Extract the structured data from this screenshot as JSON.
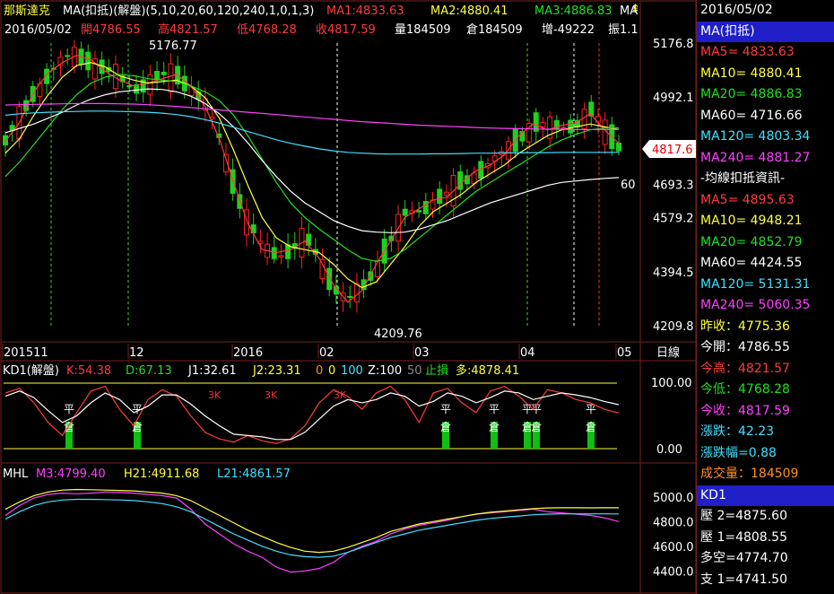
{
  "header": {
    "name": "那斯達克",
    "ma_title": "MA(扣抵)(解盤)(5,10,20,60,120,240,1,0,1,3)",
    "ma1": "MA1:4833.63",
    "ma2": "MA2:4880.41",
    "ma3": "MA3:4886.83",
    "ma_more": "MA",
    "date": "2016/05/02",
    "open": "開4786.55",
    "high": "高4821.57",
    "low": "低4768.28",
    "close": "收4817.59",
    "vol": "量184509",
    "pos": "倉184509",
    "chg": "增-49222",
    "amp": "振1.1"
  },
  "annotations": {
    "peak": "5176.77",
    "trough": "4209.76",
    "ma60_tag": "60",
    "last_price": "4817.6"
  },
  "price_axis": [
    "5176.8",
    "4992.1",
    "4807.6",
    "4693.3",
    "4579.2",
    "4394.5",
    "4209.8"
  ],
  "time_axis": [
    "201511",
    "12",
    "2016",
    "02",
    "03",
    "04",
    "05"
  ],
  "period_label": "日線",
  "kd": {
    "title": "KD1(解盤)",
    "k": "K:54.38",
    "d": "D:67.13",
    "j1": "J1:32.61",
    "j2": "J2:23.31",
    "params": [
      "0",
      "0",
      "100",
      "Z:100",
      "50"
    ],
    "stop": "止損",
    "long": "多:4878.41",
    "axis": [
      "100.00",
      "0.00"
    ],
    "ping": "平",
    "cang": "倉",
    "three_k": "3K"
  },
  "mhl": {
    "title": "MHL",
    "m3": "M3:4799.40",
    "h21": "H21:4911.68",
    "l21": "L21:4861.57",
    "axis": [
      "5000.0",
      "4800.0",
      "4600.0",
      "4400.0"
    ]
  },
  "sidebar": {
    "date": "2016/05/02",
    "ma_head": "MA(扣抵)",
    "ma": [
      {
        "label": "MA5= 4833.63",
        "color": "#ff3b3b"
      },
      {
        "label": "MA10= 4880.41",
        "color": "#ffff40"
      },
      {
        "label": "MA20= 4886.83",
        "color": "#20e020"
      },
      {
        "label": "MA60= 4716.66",
        "color": "#ffffff"
      },
      {
        "label": "MA120= 4803.34",
        "color": "#40e0ff"
      },
      {
        "label": "MA240= 4881.27",
        "color": "#ff40ff"
      }
    ],
    "deduct_head": "-均線扣抵資訊-",
    "deduct": [
      {
        "label": "MA5= 4895.63",
        "color": "#ff3b3b"
      },
      {
        "label": "MA10= 4948.21",
        "color": "#ffff40"
      },
      {
        "label": "MA20= 4852.79",
        "color": "#20e020"
      },
      {
        "label": "MA60= 4424.55",
        "color": "#ffffff"
      },
      {
        "label": "MA120= 5131.31",
        "color": "#40e0ff"
      },
      {
        "label": "MA240= 5060.35",
        "color": "#ff40ff"
      }
    ],
    "quote": [
      {
        "label": "昨收：4775.36",
        "color": "#ffff40"
      },
      {
        "label": "今開：4786.55",
        "color": "#ffffff"
      },
      {
        "label": "今高：4821.57",
        "color": "#ff3b3b"
      },
      {
        "label": "今低：4768.28",
        "color": "#20e020"
      },
      {
        "label": "今收：4817.59",
        "color": "#ff40ff"
      },
      {
        "label": "漲跌：42.23",
        "color": "#40e0ff"
      },
      {
        "label": "漲跌幅=0.88",
        "color": "#40e0ff"
      },
      {
        "label": "成交量：184509",
        "color": "#ff9020"
      }
    ],
    "kd_head": "KD1",
    "kd_rows": [
      {
        "label": "壓 2=4875.60",
        "color": "#ffffff"
      },
      {
        "label": "壓 1=4808.55",
        "color": "#ffffff"
      },
      {
        "label": "多空=4774.70",
        "color": "#ffffff"
      },
      {
        "label": "支 1=4741.50",
        "color": "#ffffff"
      }
    ]
  },
  "colors": {
    "up": "#ff2020",
    "down": "#20d020",
    "ma5": "#ff3b3b",
    "ma10": "#ffff40",
    "ma20": "#20e020",
    "ma60": "#ffffff",
    "ma120": "#40e0ff",
    "ma240": "#ff40ff",
    "frame": "#7a1f1f",
    "dashed_green": "#30e030",
    "dashed_white": "#ffffff",
    "dashed_red": "#ff3030"
  },
  "chart_data": [
    {
      "type": "line",
      "panel": "price",
      "title": "MA(扣抵)(解盤)(5,10,20,60,120,240,1,0,1,3)",
      "xlabel": "",
      "ylabel": "",
      "ylim": [
        4209.8,
        5176.8
      ],
      "x_ticks": [
        "201511",
        "12",
        "2016",
        "02",
        "03",
        "04",
        "05"
      ],
      "y_ticks": [
        5176.8,
        4992.1,
        4807.6,
        4693.3,
        4579.2,
        4394.5,
        4209.8
      ],
      "candles_summary": {
        "peak": 5176.77,
        "trough": 4209.76,
        "last_close": 4817.59
      },
      "series": [
        {
          "name": "MA5",
          "color": "#ff3b3b",
          "values": [
            4840,
            4905,
            5010,
            5075,
            5110,
            5135,
            5120,
            5080,
            5050,
            5030,
            5040,
            5055,
            5070,
            5030,
            4960,
            4850,
            4700,
            4560,
            4470,
            4460,
            4470,
            4500,
            4440,
            4350,
            4290,
            4330,
            4420,
            4500,
            4580,
            4610,
            4640,
            4650,
            4700,
            4740,
            4760,
            4795,
            4860,
            4900,
            4880,
            4895,
            4905,
            4935,
            4880,
            4833.63
          ]
        },
        {
          "name": "MA10",
          "color": "#ffff40",
          "values": [
            4800,
            4850,
            4930,
            5000,
            5060,
            5100,
            5110,
            5095,
            5065,
            5050,
            5040,
            5045,
            5050,
            5030,
            4990,
            4920,
            4810,
            4690,
            4580,
            4510,
            4480,
            4470,
            4460,
            4420,
            4370,
            4340,
            4360,
            4420,
            4480,
            4550,
            4600,
            4630,
            4660,
            4700,
            4730,
            4760,
            4800,
            4830,
            4860,
            4880,
            4890,
            4900,
            4890,
            4880.41
          ]
        },
        {
          "name": "MA20",
          "color": "#20e020",
          "values": [
            4720,
            4770,
            4830,
            4890,
            4950,
            5000,
            5040,
            5060,
            5070,
            5065,
            5055,
            5050,
            5045,
            5030,
            5010,
            4980,
            4930,
            4860,
            4780,
            4700,
            4630,
            4580,
            4540,
            4505,
            4470,
            4440,
            4430,
            4440,
            4470,
            4510,
            4550,
            4590,
            4630,
            4670,
            4700,
            4730,
            4760,
            4790,
            4820,
            4845,
            4865,
            4880,
            4886,
            4886.83
          ]
        },
        {
          "name": "MA60",
          "color": "#ffffff",
          "values": [
            4870,
            4885,
            4900,
            4920,
            4940,
            4965,
            4985,
            5000,
            5010,
            5015,
            5020,
            5018,
            5010,
            4995,
            4970,
            4935,
            4890,
            4835,
            4775,
            4720,
            4670,
            4630,
            4600,
            4570,
            4550,
            4535,
            4530,
            4528,
            4530,
            4540,
            4555,
            4570,
            4590,
            4610,
            4630,
            4645,
            4660,
            4675,
            4690,
            4700,
            4705,
            4710,
            4714,
            4716.66
          ]
        },
        {
          "name": "MA120",
          "color": "#40e0ff",
          "values": [
            4930,
            4935,
            4938,
            4940,
            4942,
            4943,
            4944,
            4944,
            4943,
            4942,
            4940,
            4937,
            4932,
            4925,
            4915,
            4903,
            4889,
            4874,
            4860,
            4846,
            4834,
            4824,
            4815,
            4808,
            4803,
            4800,
            4798,
            4797,
            4797,
            4797,
            4798,
            4798,
            4799,
            4800,
            4800,
            4801,
            4801,
            4802,
            4802,
            4803,
            4803,
            4803,
            4803,
            4803.34
          ]
        },
        {
          "name": "MA240",
          "color": "#ff40ff",
          "values": [
            4965,
            4966,
            4967,
            4968,
            4969,
            4970,
            4970,
            4970,
            4969,
            4968,
            4966,
            4963,
            4960,
            4956,
            4952,
            4948,
            4944,
            4940,
            4936,
            4932,
            4928,
            4924,
            4920,
            4916,
            4912,
            4908,
            4905,
            4902,
            4899,
            4896,
            4894,
            4892,
            4890,
            4888,
            4886,
            4885,
            4884,
            4883,
            4882,
            4882,
            4881,
            4881,
            4881,
            4881.27
          ]
        }
      ]
    },
    {
      "type": "line",
      "panel": "kd",
      "title": "KD1(解盤)",
      "ylim": [
        0,
        100
      ],
      "y_ticks": [
        100,
        0
      ],
      "series": [
        {
          "name": "K",
          "color": "#ff3b3b",
          "values": [
            85,
            92,
            70,
            40,
            20,
            55,
            88,
            95,
            60,
            35,
            75,
            90,
            80,
            50,
            25,
            15,
            10,
            20,
            12,
            8,
            15,
            35,
            70,
            90,
            80,
            60,
            85,
            95,
            75,
            40,
            85,
            92,
            70,
            55,
            88,
            95,
            80,
            60,
            90,
            85,
            75,
            70,
            60,
            54.38
          ]
        },
        {
          "name": "D",
          "color": "#ffffff",
          "values": [
            80,
            88,
            78,
            58,
            40,
            50,
            70,
            85,
            75,
            55,
            65,
            82,
            82,
            68,
            50,
            35,
            22,
            20,
            18,
            14,
            14,
            25,
            45,
            65,
            75,
            70,
            75,
            85,
            80,
            65,
            72,
            85,
            80,
            70,
            78,
            88,
            85,
            75,
            80,
            85,
            82,
            78,
            72,
            67.13
          ]
        }
      ]
    },
    {
      "type": "line",
      "panel": "mhl",
      "title": "MHL",
      "ylim": [
        4300,
        5100
      ],
      "y_ticks": [
        5000,
        4800,
        4600,
        4400
      ],
      "series": [
        {
          "name": "M3",
          "color": "#ff40ff",
          "values": [
            4850,
            4930,
            4990,
            5020,
            5030,
            5025,
            5030,
            5040,
            5035,
            5030,
            5020,
            5010,
            4990,
            4900,
            4780,
            4700,
            4620,
            4560,
            4510,
            4430,
            4390,
            4400,
            4420,
            4470,
            4550,
            4600,
            4640,
            4700,
            4740,
            4770,
            4790,
            4810,
            4840,
            4860,
            4870,
            4880,
            4890,
            4900,
            4880,
            4870,
            4860,
            4850,
            4830,
            4799.4
          ]
        },
        {
          "name": "H21",
          "color": "#ffff40",
          "values": [
            4900,
            4960,
            5010,
            5040,
            5055,
            5060,
            5058,
            5055,
            5052,
            5048,
            5040,
            5030,
            5010,
            4970,
            4910,
            4850,
            4790,
            4730,
            4680,
            4630,
            4590,
            4560,
            4550,
            4560,
            4590,
            4630,
            4670,
            4720,
            4750,
            4780,
            4800,
            4820,
            4840,
            4860,
            4875,
            4885,
            4895,
            4905,
            4910,
            4912,
            4912,
            4911,
            4912,
            4911.68
          ]
        },
        {
          "name": "L21",
          "color": "#40e0ff",
          "values": [
            4820,
            4880,
            4930,
            4960,
            4975,
            4980,
            4980,
            4978,
            4975,
            4970,
            4960,
            4945,
            4920,
            4880,
            4820,
            4760,
            4700,
            4650,
            4600,
            4560,
            4530,
            4515,
            4510,
            4520,
            4550,
            4590,
            4630,
            4670,
            4700,
            4730,
            4750,
            4770,
            4790,
            4810,
            4825,
            4835,
            4845,
            4855,
            4860,
            4862,
            4862,
            4862,
            4862,
            4861.57
          ]
        }
      ]
    }
  ]
}
